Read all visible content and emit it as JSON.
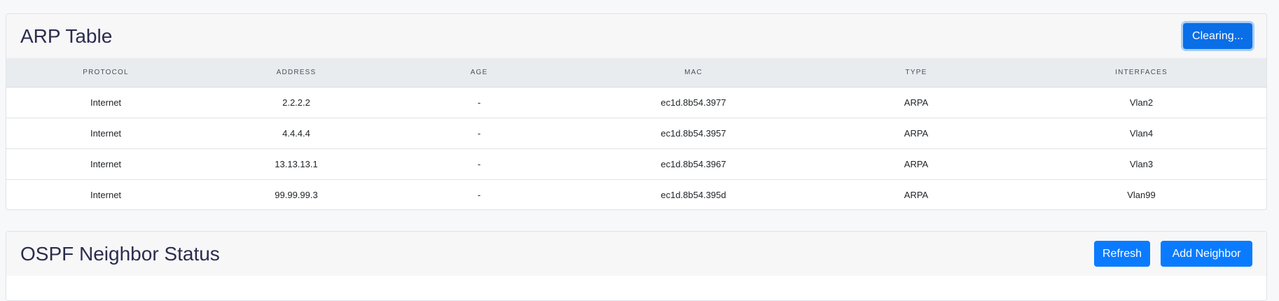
{
  "arp": {
    "title": "ARP Table",
    "clear_label": "Clearing...",
    "columns": [
      "PROTOCOL",
      "ADDRESS",
      "AGE",
      "MAC",
      "TYPE",
      "INTERFACES"
    ],
    "rows": [
      [
        "Internet",
        "2.2.2.2",
        "-",
        "ec1d.8b54.3977",
        "ARPA",
        "Vlan2"
      ],
      [
        "Internet",
        "4.4.4.4",
        "-",
        "ec1d.8b54.3957",
        "ARPA",
        "Vlan4"
      ],
      [
        "Internet",
        "13.13.13.1",
        "-",
        "ec1d.8b54.3967",
        "ARPA",
        "Vlan3"
      ],
      [
        "Internet",
        "99.99.99.3",
        "-",
        "ec1d.8b54.395d",
        "ARPA",
        "Vlan99"
      ]
    ]
  },
  "ospf": {
    "title": "OSPF Neighbor Status",
    "refresh_label": "Refresh",
    "add_label": "Add Neighbor"
  },
  "colors": {
    "primary": "#0a7bff",
    "page_bg": "#f7f8fa",
    "header_bg": "#e9ecef",
    "title_text": "#2b2d4e"
  }
}
